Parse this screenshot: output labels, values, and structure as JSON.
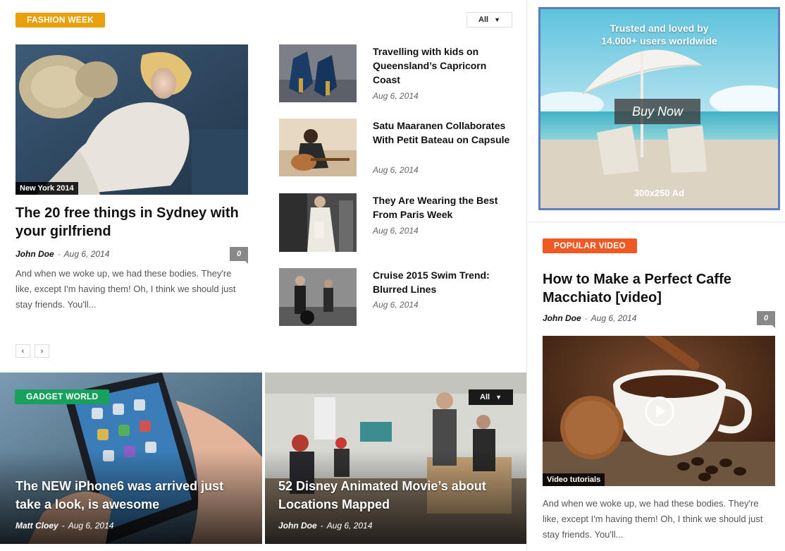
{
  "fashion": {
    "badge": "FASHION WEEK",
    "filter": "All",
    "main": {
      "caption": "New York 2014",
      "title": "The 20 free things in Sydney with your girlfriend",
      "author": "John Doe",
      "date": "Aug 6, 2014",
      "comments": "0",
      "excerpt": "And when we woke up, we had these bodies. They're like, except I'm having them! Oh, I think we should just stay friends. You'll..."
    },
    "items": [
      {
        "title": "Travelling with kids on Queensland’s Capricorn Coast",
        "date": "Aug 6, 2014"
      },
      {
        "title": "Satu Maaranen Collaborates With Petit Bateau on Capsule",
        "date": "Aug 6, 2014"
      },
      {
        "title": "They Are Wearing the Best From Paris Week",
        "date": "Aug 6, 2014"
      },
      {
        "title": "Cruise 2015 Swim Trend: Blurred Lines",
        "date": "Aug 6, 2014"
      }
    ],
    "prev_icon": "‹",
    "next_icon": "›"
  },
  "gadget": {
    "badge": "GADGET WORLD",
    "filter": "All",
    "left": {
      "title": "The NEW iPhone6 was arrived just take a look, is awesome",
      "author": "Matt Cloey",
      "date": "Aug 6, 2014"
    },
    "right": {
      "title": "52 Disney Animated Movie’s about Locations Mapped",
      "author": "John Doe",
      "date": "Aug 6, 2014"
    }
  },
  "ad": {
    "headline_1": "Trusted and loved by",
    "headline_2": "14.000+ users worldwide",
    "button": "Buy Now",
    "size_label": "300x250 Ad"
  },
  "popular_video": {
    "badge": "POPULAR VIDEO",
    "title": "How to Make a Perfect Caffe Macchiato [video]",
    "author": "John Doe",
    "date": "Aug 6, 2014",
    "comments": "0",
    "caption": "Video tutorials",
    "excerpt": "And when we woke up, we had these bodies. They're like, except I'm having them! Oh, I think we should just stay friends. You'll..."
  },
  "colors": {
    "fashion_badge": "#e8a10d",
    "video_badge": "#ef5a24",
    "gadget_badge": "#17a05e",
    "ad_border": "#5b7fc2"
  }
}
